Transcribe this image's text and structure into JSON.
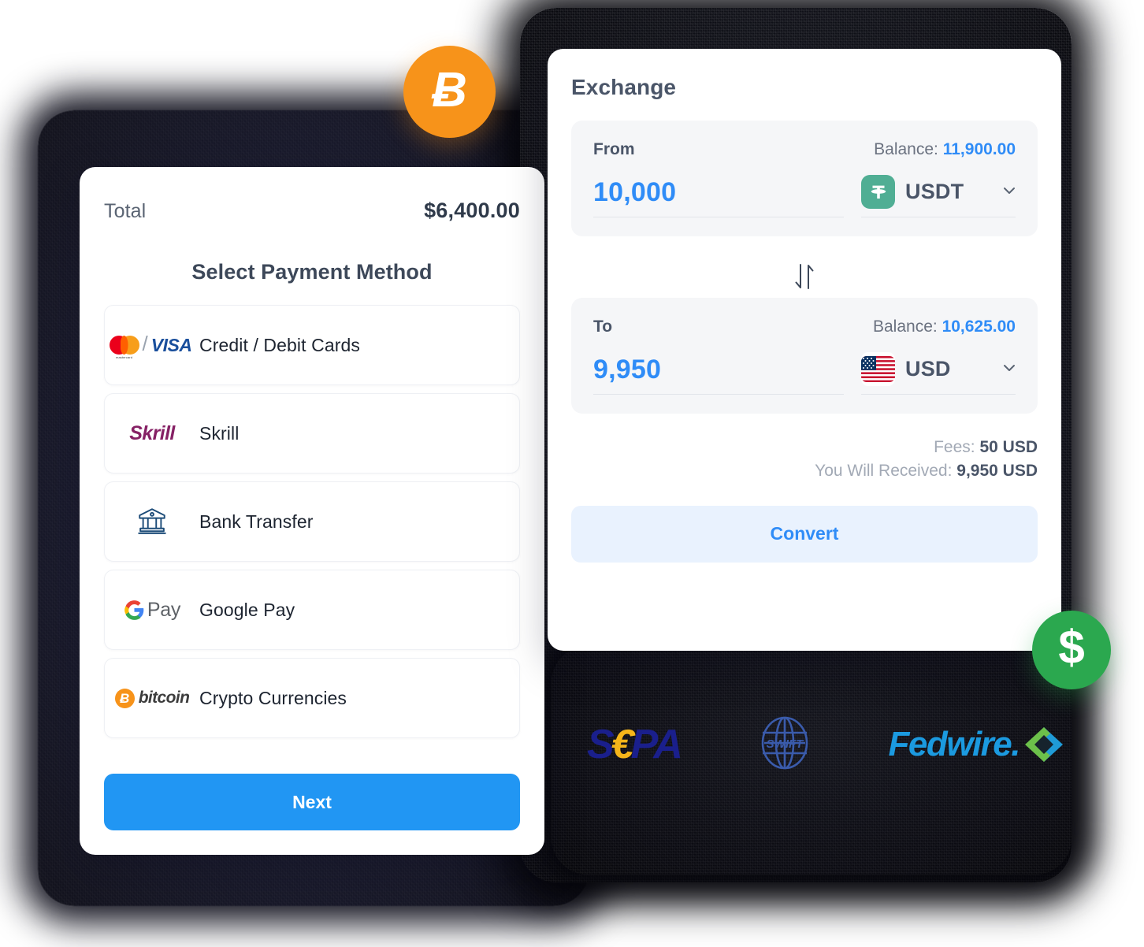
{
  "payment_card": {
    "total_label": "Total",
    "total_value": "$6,400.00",
    "title": "Select Payment Method",
    "methods": [
      {
        "label": "Credit / Debit Cards",
        "logo": "mastercard-visa-logo",
        "brand_mastercard": "mastercard",
        "brand_visa": "VISA"
      },
      {
        "label": "Skrill",
        "logo": "skrill-logo",
        "wordmark": "Skrill"
      },
      {
        "label": "Bank Transfer",
        "logo": "bank-icon"
      },
      {
        "label": "Google Pay",
        "logo": "google-pay-logo",
        "g": "G",
        "pay": "Pay"
      },
      {
        "label": "Crypto Currencies",
        "logo": "bitcoin-logo",
        "symbol": "Ƀ",
        "wordmark": "bitcoin"
      }
    ],
    "next_label": "Next"
  },
  "exchange_card": {
    "title": "Exchange",
    "from": {
      "direction_label": "From",
      "balance_label": "Balance:",
      "balance_value": "11,900.00",
      "amount": "10,000",
      "currency": "USDT",
      "currency_icon": "tether-icon",
      "chevron": "chevron-down-icon"
    },
    "swap_icon": "swap-vertical-icon",
    "to": {
      "direction_label": "To",
      "balance_label": "Balance:",
      "balance_value": "10,625.00",
      "amount": "9,950",
      "currency": "USD",
      "currency_icon": "us-flag-icon",
      "chevron": "chevron-down-icon"
    },
    "fees_label": "Fees:",
    "fees_value": "50 USD",
    "received_label": "You Will Received:",
    "received_value": "9,950 USD",
    "convert_label": "Convert"
  },
  "badges": {
    "bitcoin": {
      "name": "bitcoin-badge",
      "symbol": "Ƀ",
      "color": "#f7931a"
    },
    "dollar": {
      "name": "dollar-badge",
      "symbol": "$",
      "color": "#2ba84f"
    }
  },
  "partners": [
    {
      "name": "sepa-logo",
      "s": "S",
      "euro": "€",
      "pa": "PA"
    },
    {
      "name": "swift-logo",
      "text": "SWIFT"
    },
    {
      "name": "fedwire-logo",
      "text": "Fedwire."
    }
  ],
  "colors": {
    "accent_blue": "#2196f3",
    "link_blue": "#2f8cf7",
    "bitcoin_orange": "#f7931a",
    "dollar_green": "#2ba84f",
    "tether_green": "#50ae94",
    "sepa_blue": "#1a1f8c",
    "fedwire_blue": "#1b9ae0"
  }
}
